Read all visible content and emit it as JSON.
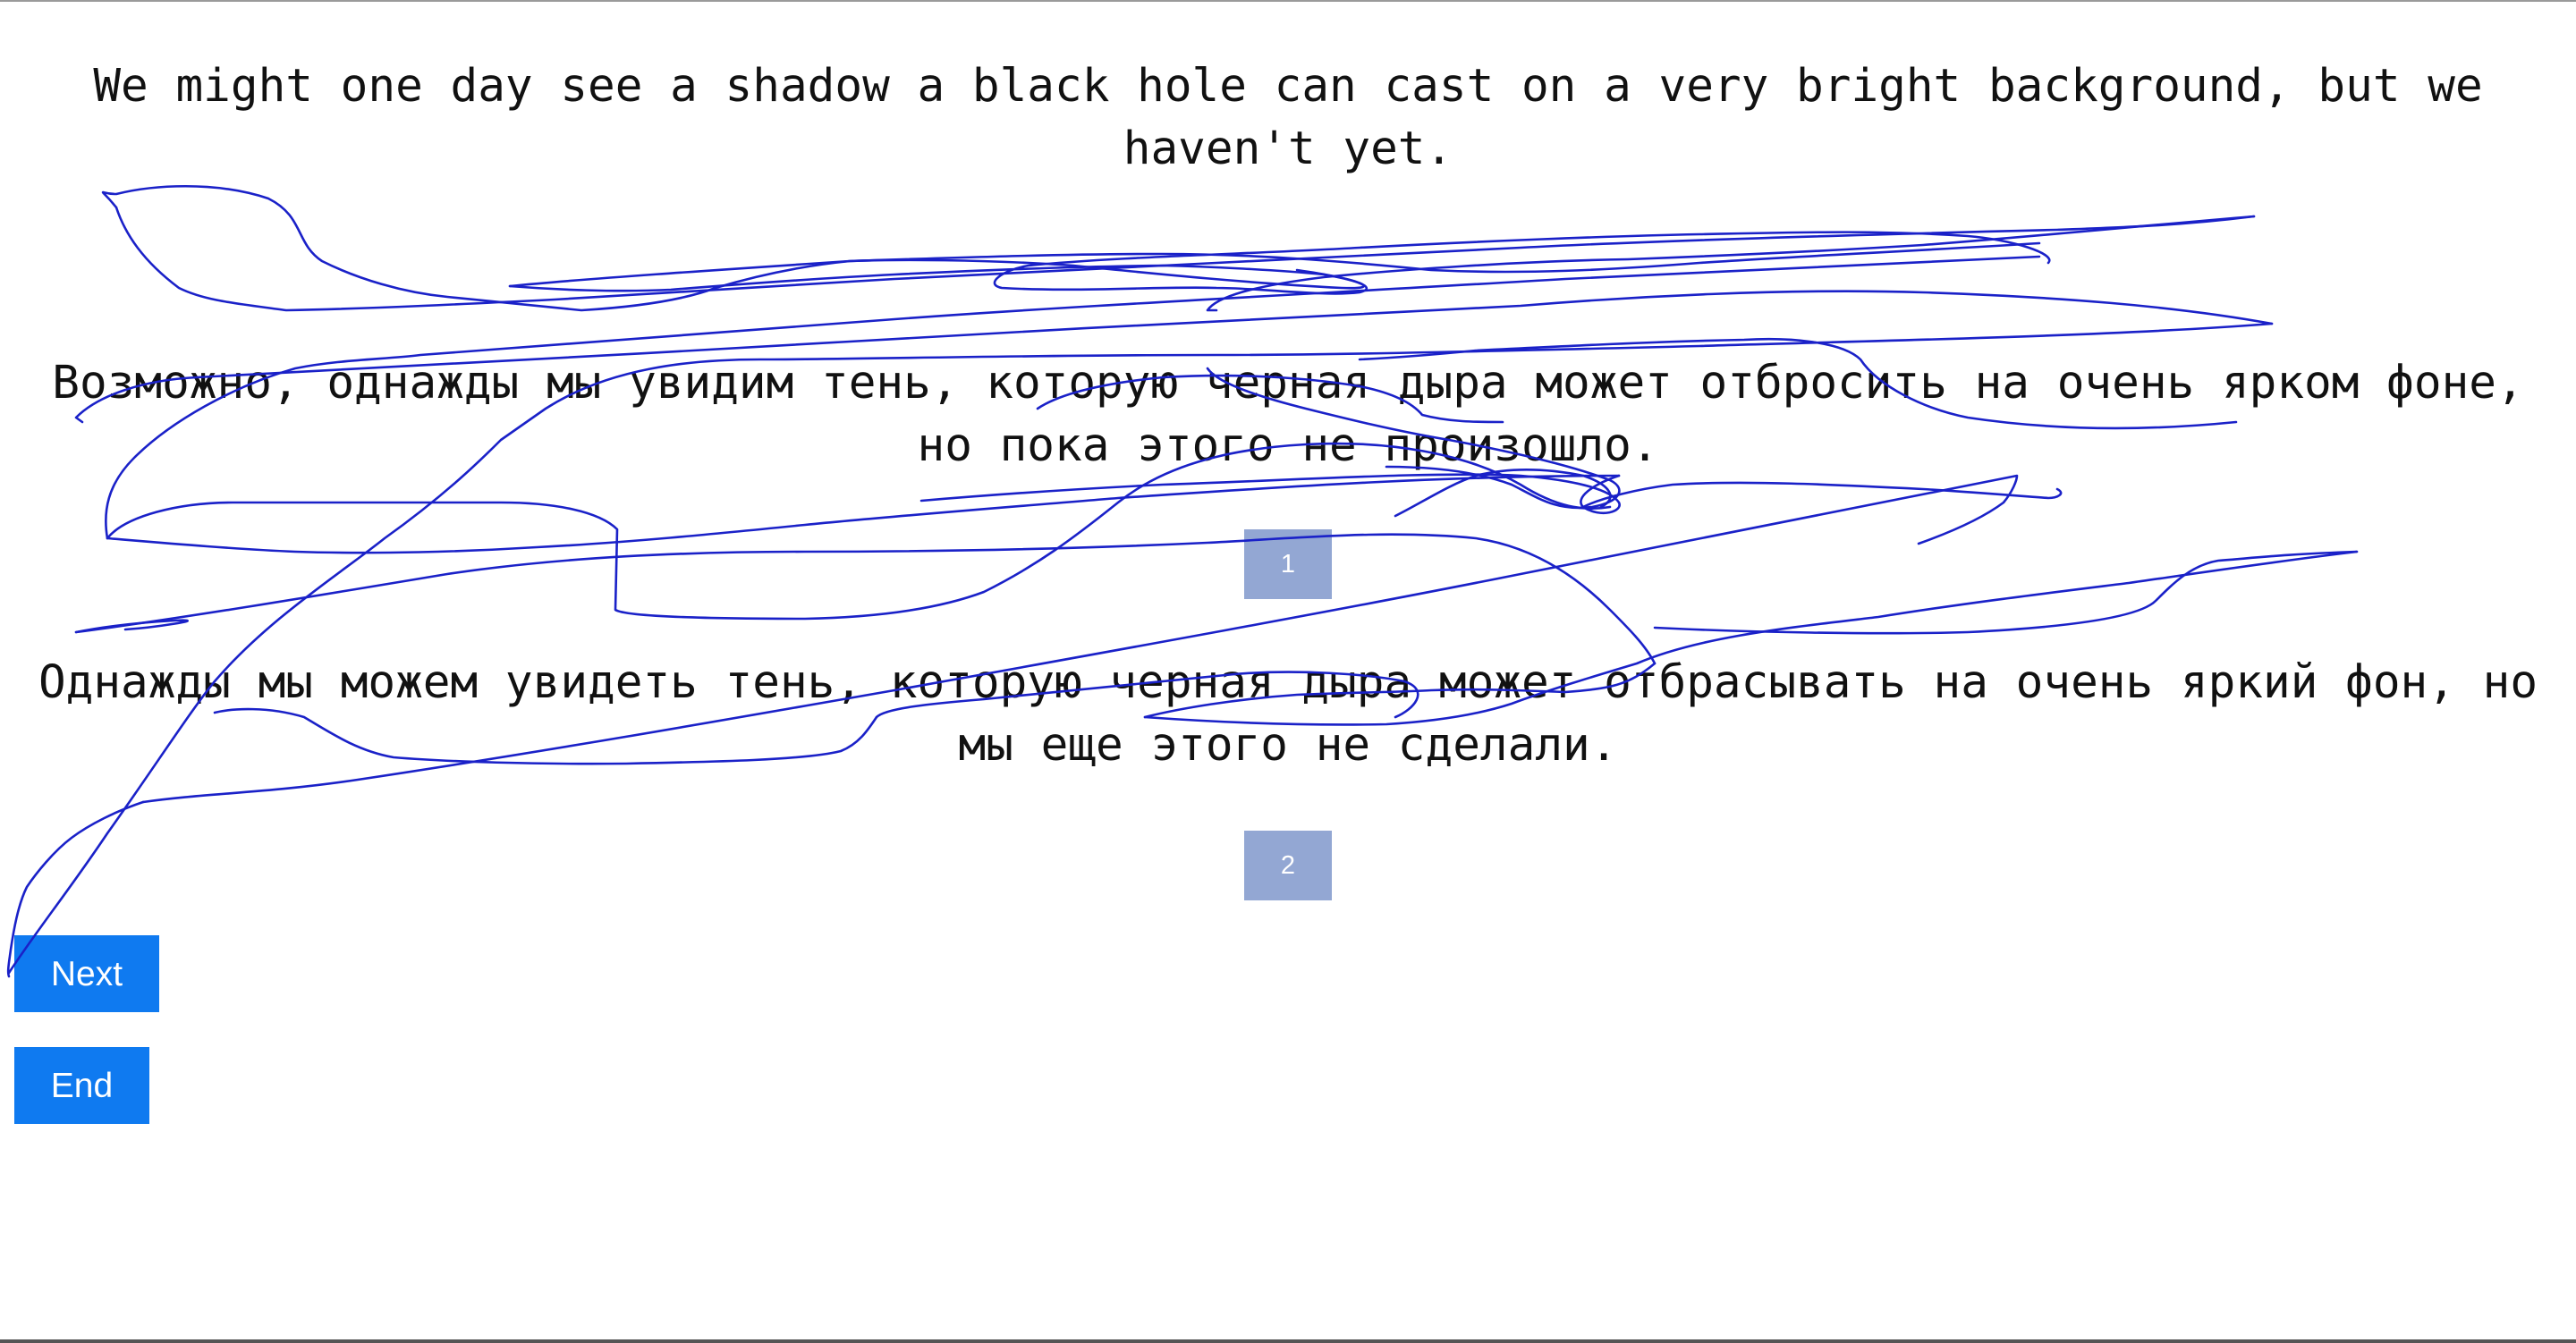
{
  "sentences": {
    "source": "We might one day see a shadow a black hole can cast on a very bright background, but we haven't yet.",
    "translation_1": "Возможно, однажды мы увидим тень, которую черная дыра может отбросить на очень ярком фоне, но пока этого не произошло.",
    "translation_2": "Однажды мы можем увидеть тень, которую черная дыра может отбрасывать на очень яркий фон, но мы еще этого не сделали."
  },
  "rank_badges": {
    "first": "1",
    "second": "2"
  },
  "buttons": {
    "next_label": "Next",
    "end_label": "End"
  },
  "colors": {
    "scribble_stroke": "#1a21c8",
    "badge_background": "#93a7d3",
    "button_background": "#0f7af0"
  }
}
